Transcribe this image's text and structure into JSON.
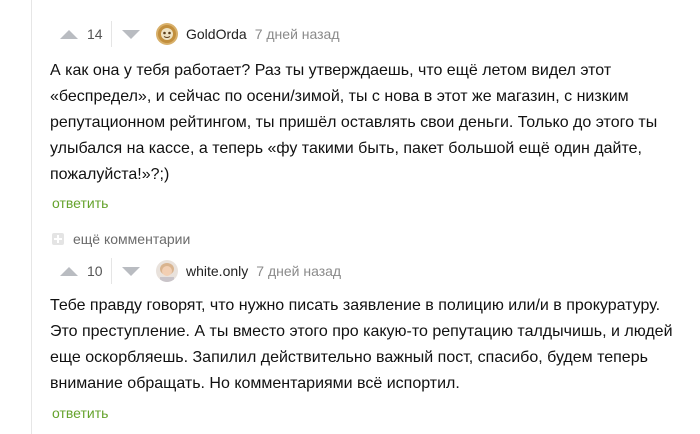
{
  "comments": [
    {
      "rating": "14",
      "username": "GoldOrda",
      "time": "7 дней назад",
      "text": "А как она у тебя работает? Раз ты утверждаешь, что ещё летом видел этот «беспредел», и сейчас по осени/зимой, ты с нова в этот же магазин, с низким репутационном рейтингом, ты пришёл оставлять свои деньги. Только до этого ты улыбался на кассе, а теперь «фу такими быть, пакет большой ещё один дайте, пожалуйста!»?;)",
      "reply_label": "ответить"
    },
    {
      "rating": "10",
      "username": "white.only",
      "time": "7 дней назад",
      "text": "Тебе правду говорят, что нужно писать заявление в полицию или/и в прокуратуру. Это преступление. А ты вместо этого про какую-то репутацию талдычишь, и людей еще оскорбляешь. Запилил действительно важный пост, спасибо, будем теперь внимание обращать. Но комментариями всё испортил.",
      "reply_label": "ответить"
    }
  ],
  "more_comments_label": "ещё комментарии",
  "colors": {
    "reply_link": "#65a32c",
    "vote_arrow": "#b9bcc1",
    "time": "#8a8a8a"
  },
  "icons": {
    "vote_up": "triangle-up-icon",
    "vote_down": "triangle-down-icon",
    "expand": "plus-square-icon"
  }
}
